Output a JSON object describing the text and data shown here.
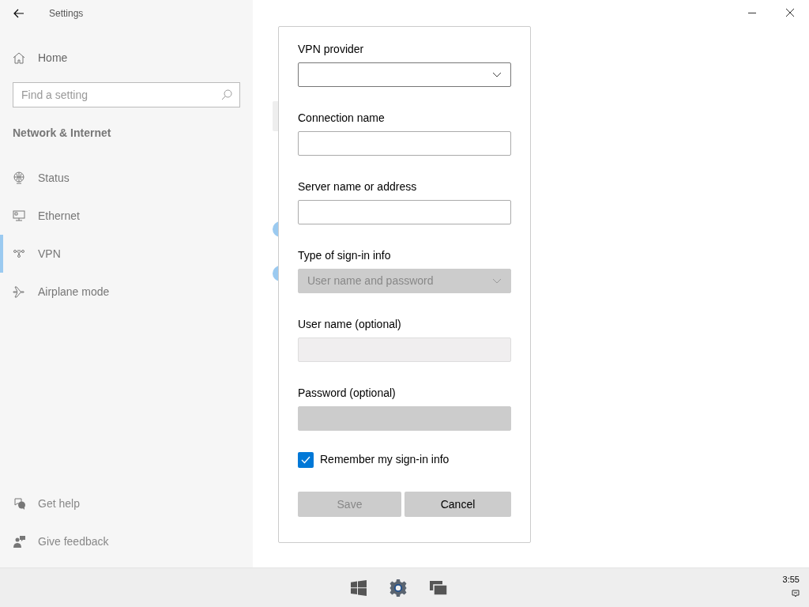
{
  "window": {
    "title": "Settings"
  },
  "sidebar": {
    "home": "Home",
    "search": {
      "placeholder": "Find a setting"
    },
    "section": "Network & Internet",
    "items": [
      {
        "label": "Status",
        "selected": false
      },
      {
        "label": "Ethernet",
        "selected": false
      },
      {
        "label": "VPN",
        "selected": true
      },
      {
        "label": "Airplane mode",
        "selected": false
      }
    ],
    "footer": [
      {
        "label": "Get help"
      },
      {
        "label": "Give feedback"
      }
    ]
  },
  "background": {
    "settings": [
      {
        "on": true
      },
      {
        "on": true
      }
    ]
  },
  "dialog": {
    "fields": [
      {
        "label": "VPN provider",
        "kind": "dropdown",
        "disabled": false
      },
      {
        "label": "Connection name",
        "kind": "text",
        "disabled": false
      },
      {
        "label": "Server name or address",
        "kind": "text",
        "disabled": false
      },
      {
        "label": "Type of sign-in info",
        "kind": "dropdown",
        "value": "User name and password",
        "disabled": true
      },
      {
        "label": "User name (optional)",
        "kind": "text",
        "disabled": true
      },
      {
        "label": "Password (optional)",
        "kind": "password",
        "disabled": true
      }
    ],
    "checkbox": {
      "label": "Remember my sign-in info",
      "checked": true
    },
    "buttons": [
      {
        "label": "Save",
        "disabled": true
      },
      {
        "label": "Cancel",
        "disabled": false
      }
    ]
  },
  "taskbar": {
    "clock": "3:55"
  }
}
